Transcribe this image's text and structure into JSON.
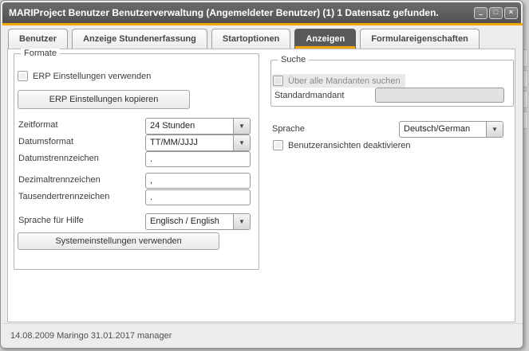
{
  "window": {
    "title": "MARIProject Benutzer Benutzerverwaltung (Angemeldeter Benutzer) (1) 1 Datensatz gefunden.",
    "controls": [
      {
        "name": "minimize",
        "glyph": "–"
      },
      {
        "name": "maximize",
        "glyph": "□"
      },
      {
        "name": "close",
        "glyph": "×"
      }
    ]
  },
  "tabs": {
    "items": [
      {
        "label": "Benutzer",
        "active": false
      },
      {
        "label": "Anzeige Stundenerfassung",
        "active": false
      },
      {
        "label": "Startoptionen",
        "active": false
      },
      {
        "label": "Anzeigen",
        "active": true
      },
      {
        "label": "Formulareigenschaften",
        "active": false
      }
    ]
  },
  "panels": {
    "formate": {
      "legend": "Formate",
      "erp_checkbox": {
        "label": "ERP Einstellungen verwenden",
        "checked": false
      },
      "erp_copy_button": "ERP Einstellungen kopieren",
      "rows": [
        {
          "label": "Zeitformat",
          "type": "combo",
          "value": "24 Stunden"
        },
        {
          "label": "Datumsformat",
          "type": "combo",
          "value": "TT/MM/JJJJ"
        },
        {
          "label": "Datumstrennzeichen",
          "type": "input",
          "value": "."
        },
        {
          "label": "Dezimaltrennzeichen",
          "type": "input",
          "value": ","
        },
        {
          "label": "Tausendertrennzeichen",
          "type": "input",
          "value": "."
        },
        {
          "label": "Sprache für Hilfe",
          "type": "combo",
          "value": "Englisch / English"
        }
      ],
      "system_button": "Systemeinstellungen verwenden"
    },
    "suche": {
      "legend": "Suche",
      "all_clients_checkbox": {
        "label": "Über alle Mandanten suchen",
        "checked": false,
        "disabled": true
      },
      "standardmandant": {
        "label": "Standardmandant",
        "value": "",
        "disabled": true
      }
    },
    "sprache_row": {
      "label": "Sprache",
      "value": "Deutsch/German"
    },
    "benutzeransichten_checkbox": {
      "label": "Benutzeransichten deaktivieren",
      "checked": false
    }
  },
  "statusbar": {
    "text": "14.08.2009 Maringo 31.01.2017 manager"
  },
  "icons": {
    "dropdown_arrow": "▼"
  },
  "colors": {
    "accent_orange": "#F5A607",
    "titlebar": "#58585A",
    "active_tab": "#59595B"
  }
}
